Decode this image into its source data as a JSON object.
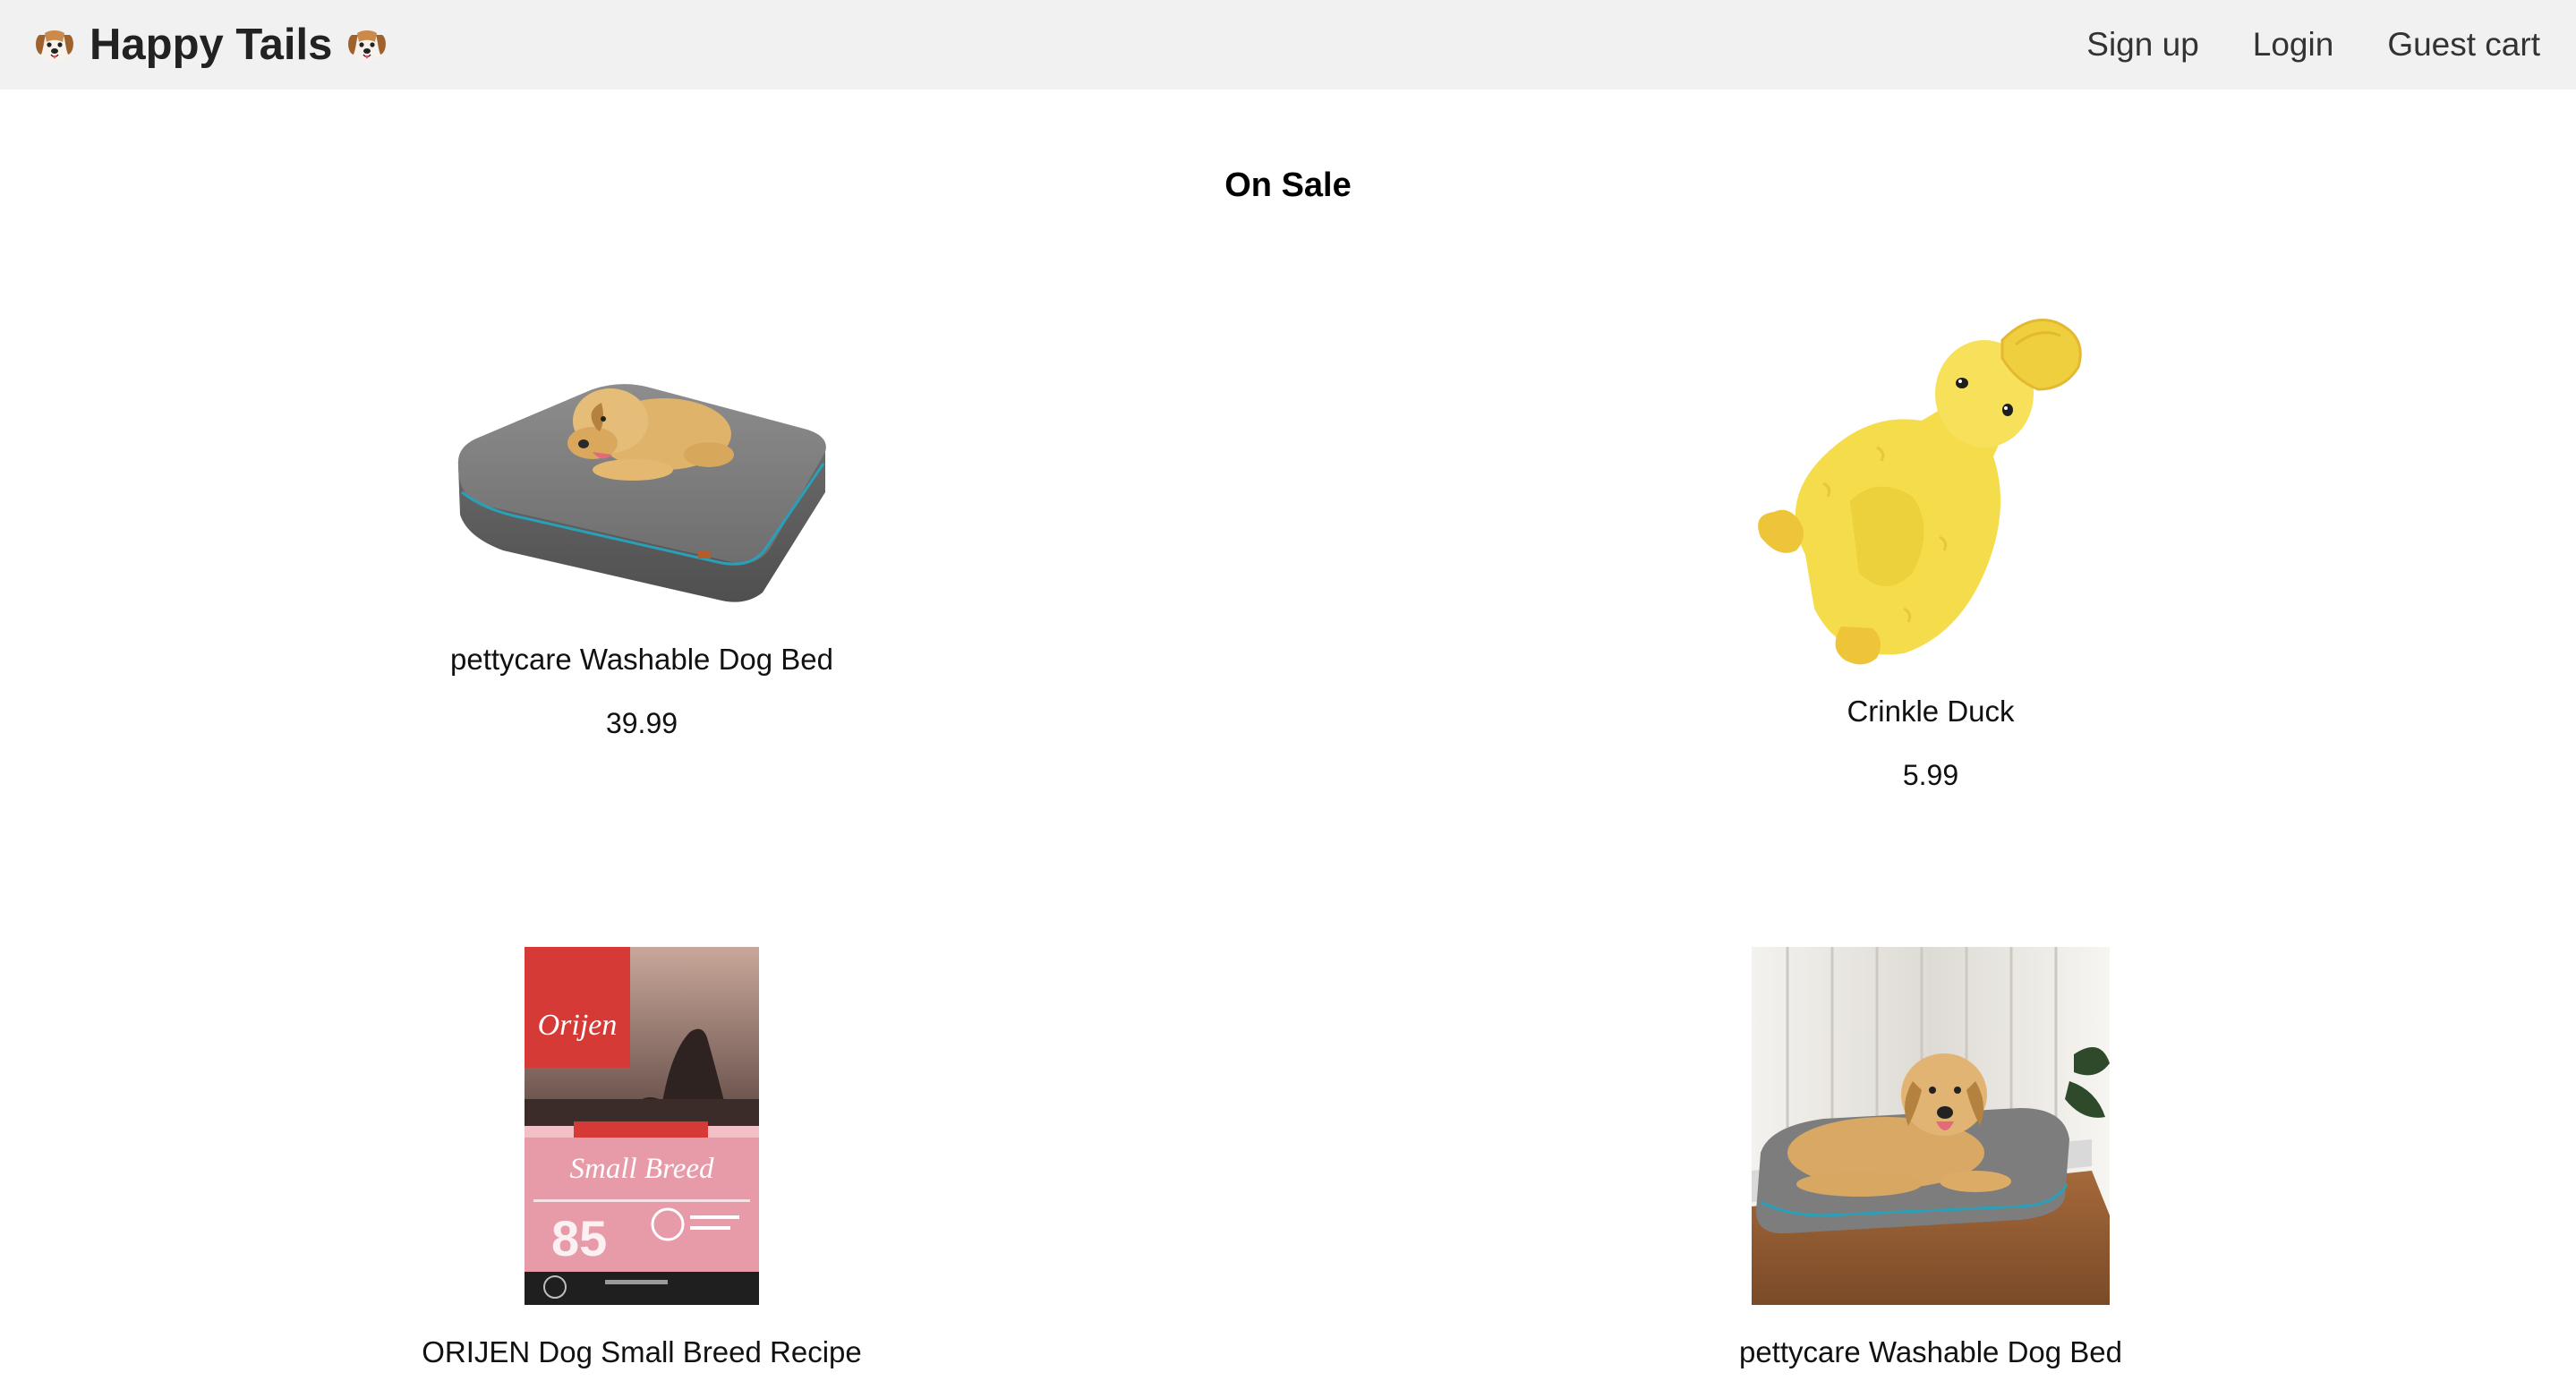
{
  "header": {
    "brand": {
      "title": "Happy Tails",
      "leading_icon": "dog-face-icon",
      "trailing_icon": "dog-face-icon"
    },
    "nav": [
      {
        "label": "Sign up"
      },
      {
        "label": "Login"
      },
      {
        "label": "Guest cart"
      }
    ],
    "background_color": "#f1f1f1"
  },
  "main": {
    "section_title": "On Sale",
    "products": [
      {
        "name": "pettycare Washable Dog Bed",
        "price": "39.99",
        "image": "dog-on-gray-bed-photo"
      },
      {
        "name": "Crinkle Duck",
        "price": "5.99",
        "image": "yellow-plush-duck-toy-photo"
      },
      {
        "name": "ORIJEN Dog Small Breed Recipe",
        "price": "",
        "image": "orijen-food-bag-photo",
        "image_text": {
          "brand": "Orijen",
          "line": "Small Breed",
          "percent": "85"
        }
      },
      {
        "name": "pettycare Washable Dog Bed",
        "price": "",
        "image": "dog-on-bed-room-photo"
      }
    ]
  }
}
